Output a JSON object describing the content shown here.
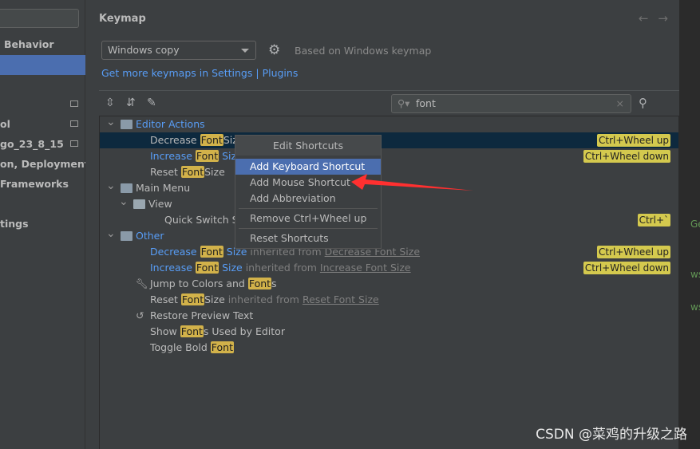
{
  "sidebar": {
    "items": [
      "Behavior",
      "",
      "",
      "ol",
      "go_23_8_15",
      "on, Deployment",
      "Frameworks",
      "",
      "tings"
    ]
  },
  "header": {
    "title": "Keymap",
    "back": "←",
    "forward": "→"
  },
  "keymap": {
    "selected": "Windows copy",
    "based_on": "Based on Windows keymap",
    "link_text": "Get more keymaps in Settings",
    "link_sep": " | ",
    "link_plugins": "Plugins"
  },
  "search": {
    "value": "font",
    "clear": "×"
  },
  "tree": [
    {
      "depth": 0,
      "chev": true,
      "icon": "folder-actions",
      "segs": [
        [
          "blue",
          "Editor Actions"
        ]
      ]
    },
    {
      "depth": 2,
      "selected": true,
      "segs": [
        [
          "",
          "Decrease "
        ],
        [
          "hl",
          "Font"
        ],
        [
          "",
          "Size"
        ]
      ],
      "shortcut": "Ctrl+Wheel up"
    },
    {
      "depth": 2,
      "segs": [
        [
          "blue",
          "Increase "
        ],
        [
          "hl",
          "Font"
        ],
        [
          "blue",
          " Size"
        ]
      ],
      "shortcut": "Ctrl+Wheel down"
    },
    {
      "depth": 2,
      "segs": [
        [
          "",
          "Reset "
        ],
        [
          "hl",
          "Font"
        ],
        [
          "",
          "Size"
        ]
      ]
    },
    {
      "depth": 0,
      "chev": true,
      "icon": "folder-menu",
      "segs": [
        [
          "",
          "Main Menu"
        ]
      ]
    },
    {
      "depth": 1,
      "chev": true,
      "icon": "folder",
      "segs": [
        [
          "",
          "View"
        ]
      ]
    },
    {
      "depth": 3,
      "segs": [
        [
          "",
          "Quick Switch Sc"
        ]
      ],
      "shortcut": "Ctrl+`"
    },
    {
      "depth": 0,
      "chev": true,
      "icon": "folder-other",
      "segs": [
        [
          "blue",
          "Other"
        ]
      ]
    },
    {
      "depth": 2,
      "segs": [
        [
          "blue",
          "Decrease "
        ],
        [
          "hl",
          "Font"
        ],
        [
          "blue",
          " Size"
        ],
        [
          "dim",
          " inherited from "
        ],
        [
          "lnk",
          "Decrease Font Size"
        ]
      ],
      "shortcut": "Ctrl+Wheel up"
    },
    {
      "depth": 2,
      "segs": [
        [
          "blue",
          "Increase "
        ],
        [
          "hl",
          "Font"
        ],
        [
          "blue",
          " Size"
        ],
        [
          "dim",
          " inherited from "
        ],
        [
          "lnk",
          "Increase Font Size"
        ]
      ],
      "shortcut": "Ctrl+Wheel down"
    },
    {
      "depth": 2,
      "icon": "wrench",
      "segs": [
        [
          "",
          "Jump to Colors and "
        ],
        [
          "hl",
          "Font"
        ],
        [
          "",
          "s"
        ]
      ]
    },
    {
      "depth": 2,
      "segs": [
        [
          "",
          "Reset "
        ],
        [
          "hl",
          "Font"
        ],
        [
          "",
          "Size"
        ],
        [
          "dim",
          " inherited from "
        ],
        [
          "lnk",
          "Reset Font Size"
        ]
      ]
    },
    {
      "depth": 2,
      "icon": "undo",
      "segs": [
        [
          "",
          "Restore Preview Text"
        ]
      ]
    },
    {
      "depth": 2,
      "segs": [
        [
          "",
          "Show "
        ],
        [
          "hl",
          "Font"
        ],
        [
          "",
          "s Used by Editor"
        ]
      ]
    },
    {
      "depth": 2,
      "segs": [
        [
          "",
          "Toggle Bold "
        ],
        [
          "hl",
          "Font"
        ]
      ]
    }
  ],
  "popup": {
    "title": "Edit Shortcuts",
    "items": [
      "Add Keyboard Shortcut",
      "Add Mouse Shortcut",
      "Add Abbreviation",
      "Remove Ctrl+Wheel up",
      "Reset Shortcuts"
    ]
  },
  "right_strip": [
    "Ge",
    "ws",
    "ws"
  ],
  "watermark": "CSDN @菜鸡的升级之路",
  "colors": {
    "selection": "#4b6eaf",
    "row_selected": "#0d293e",
    "highlight": "#d2b24a",
    "shortcut": "#d4c94e",
    "link": "#589df6",
    "arrow": "#ff3030"
  }
}
